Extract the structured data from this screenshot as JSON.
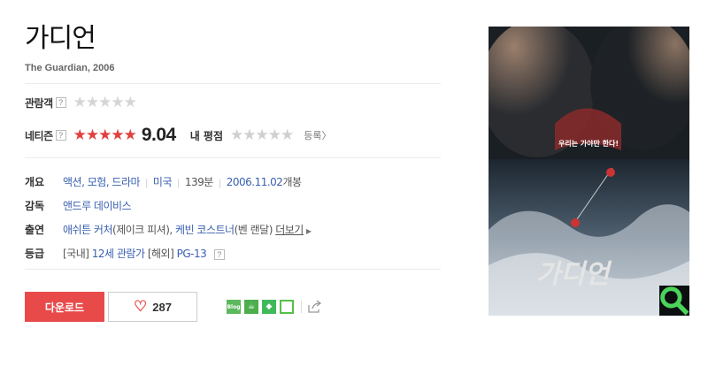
{
  "movie": {
    "title": "가디언",
    "subtitle": "The Guardian, 2006"
  },
  "ratings": {
    "audience_label": "관람객",
    "audience_help": "?",
    "audience_stars": "★★★★★",
    "netizen_label": "네티즌",
    "netizen_help": "?",
    "netizen_stars": "★★★★★",
    "netizen_score": "9.04",
    "my_rating_label": "내 평점",
    "my_stars": "★★★★★",
    "register_label": "등록〉"
  },
  "meta": {
    "overview_label": "개요",
    "genres": "액션, 모험, 드라마",
    "country": "미국",
    "runtime": "139분",
    "release_date": "2006.11.02",
    "release_suffix": "개봉",
    "director_label": "감독",
    "director": "앤드루 데이비스",
    "cast_label": "출연",
    "cast1_name": "애쉬튼 커처",
    "cast1_role": "(제이크 피셔), ",
    "cast2_name": "케빈 코스트너",
    "cast2_role": "(벤 랜달) ",
    "more_label": "더보기",
    "grade_label": "등급",
    "grade_kr_prefix": "[국내] ",
    "grade_kr": "12세 관람가",
    "grade_int_prefix": " [해외] ",
    "grade_int": "PG-13",
    "grade_help": "?"
  },
  "actions": {
    "download_label": "다운로드",
    "like_count": "287",
    "blog_icon_text": "Blog"
  },
  "poster": {
    "title_text": "가디언",
    "tagline": "우리는 가야만 한다!"
  },
  "colors": {
    "accent": "#e84a4a",
    "link": "#3a60b0",
    "star_red": "#e23f3f",
    "star_gray": "#d5d5d5"
  }
}
